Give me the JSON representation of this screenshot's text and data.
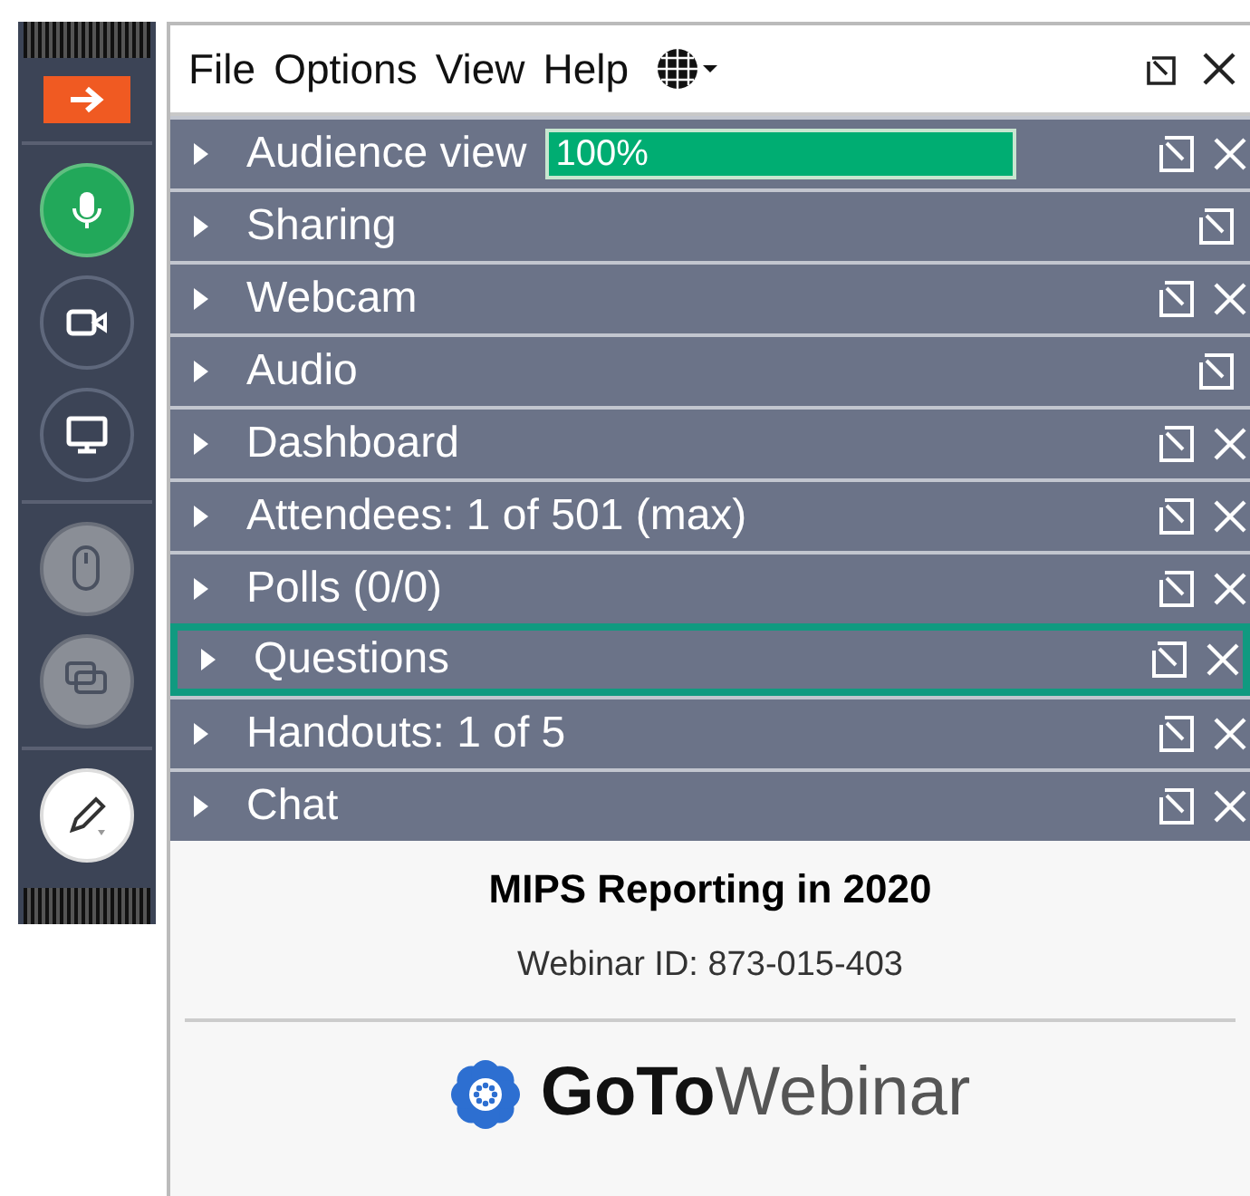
{
  "toolbar": [
    {
      "kind": "arrow",
      "on": false,
      "disabled": false
    },
    {
      "kind": "mic",
      "on": true,
      "disabled": false
    },
    {
      "kind": "webcam",
      "on": false,
      "disabled": false
    },
    {
      "kind": "screen",
      "on": false,
      "disabled": false
    },
    {
      "kind": "mouse",
      "on": false,
      "disabled": true
    },
    {
      "kind": "monitors",
      "on": false,
      "disabled": true
    },
    {
      "kind": "pen",
      "on": false,
      "disabled": false
    }
  ],
  "menu": [
    "File",
    "Options",
    "View",
    "Help"
  ],
  "panes": [
    {
      "label": "Audience view",
      "selected": false,
      "closable": true,
      "meter": {
        "level": 1,
        "reading": "100%"
      }
    },
    {
      "label": "Sharing",
      "selected": false,
      "closable": false
    },
    {
      "label": "Webcam",
      "selected": false,
      "closable": true
    },
    {
      "label": "Audio",
      "selected": false,
      "closable": false
    },
    {
      "label": "Dashboard",
      "selected": false,
      "closable": true
    },
    {
      "label": "Attendees:  1 of 501 (max)",
      "selected": false,
      "closable": true
    },
    {
      "label": "Polls (0/0)",
      "selected": false,
      "closable": true
    },
    {
      "label": "Questions",
      "selected": true,
      "closable": true
    },
    {
      "label": "Handouts: 1 of 5",
      "selected": false,
      "closable": true
    },
    {
      "label": "Chat",
      "selected": false,
      "closable": true
    }
  ],
  "webinar": {
    "title": "MIPS Reporting in 2020",
    "id": "Webinar ID: 873-015-403"
  },
  "logo": "**GoTo**Webinar"
}
